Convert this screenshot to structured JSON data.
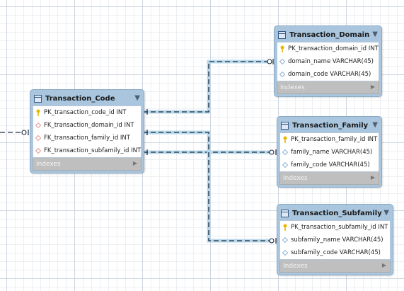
{
  "diagram": {
    "tables": {
      "transaction_code": {
        "title": "Transaction_Code",
        "columns": [
          {
            "type": "pk",
            "text": "PK_transaction_code_id INT"
          },
          {
            "type": "fk",
            "text": "FK_transaction_domain_id INT"
          },
          {
            "type": "fk",
            "text": "FK_transaction_family_id INT"
          },
          {
            "type": "fk",
            "text": "FK_transaction_subfamily_id INT"
          }
        ],
        "indexes_label": "Indexes"
      },
      "transaction_domain": {
        "title": "Transaction_Domain",
        "columns": [
          {
            "type": "pk",
            "text": "PK_transaction_domain_id INT"
          },
          {
            "type": "col",
            "text": "domain_name VARCHAR(45)"
          },
          {
            "type": "col",
            "text": "domain_code VARCHAR(45)"
          }
        ],
        "indexes_label": "Indexes"
      },
      "transaction_family": {
        "title": "Transaction_Family",
        "columns": [
          {
            "type": "pk",
            "text": "PK_transaction_family_id INT"
          },
          {
            "type": "col",
            "text": "family_name VARCHAR(45)"
          },
          {
            "type": "col",
            "text": "family_code VARCHAR(45)"
          }
        ],
        "indexes_label": "Indexes"
      },
      "transaction_subfamily": {
        "title": "Transaction_Subfamily",
        "columns": [
          {
            "type": "pk",
            "text": "PK_transaction_subfamily_id INT"
          },
          {
            "type": "col",
            "text": "subfamily_name VARCHAR(45)"
          },
          {
            "type": "col",
            "text": "subfamily_code VARCHAR(45)"
          }
        ],
        "indexes_label": "Indexes"
      }
    },
    "icons": {
      "table": "table-icon",
      "primary_key": "key-icon",
      "foreign_key": "fk-diamond-icon",
      "column": "column-diamond-icon",
      "collapse": "collapse-triangle-icon",
      "expand": "expand-arrow-icon"
    },
    "colors": {
      "table_header": "#a9c6de",
      "relation_line": "#1c2a3a",
      "relation_highlight": "#b8d8ec",
      "key": "#e8b800",
      "fk_diamond": "#e39a9a",
      "col_diamond": "#8fb3d4"
    }
  }
}
